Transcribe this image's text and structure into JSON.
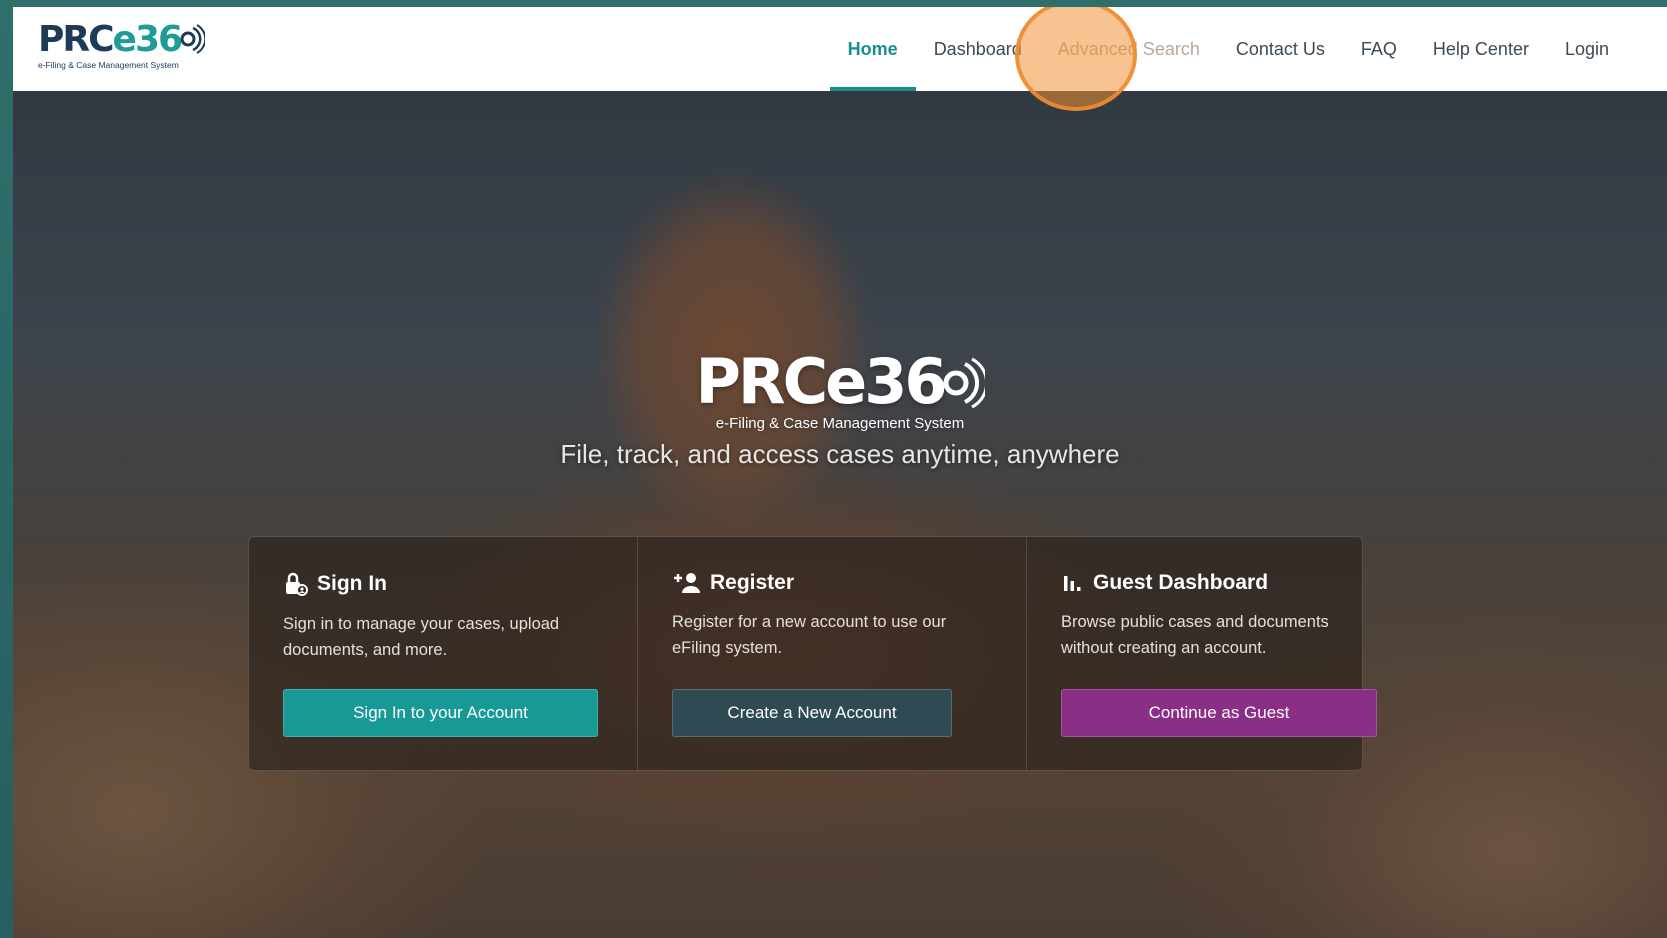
{
  "logo": {
    "prefix": "PRC",
    "accent": "e36",
    "subtitle": "e-Filing & Case Management System"
  },
  "nav": {
    "items": [
      {
        "label": "Home",
        "active": true
      },
      {
        "label": "Dashboard"
      },
      {
        "label": "Advanced Search"
      },
      {
        "label": "Contact Us"
      },
      {
        "label": "FAQ"
      },
      {
        "label": "Help Center"
      },
      {
        "label": "Login"
      }
    ]
  },
  "hero": {
    "logo_prefix": "PRC",
    "logo_accent": "e36",
    "logo_subtitle": "e-Filing & Case Management System",
    "tagline": "File, track, and access cases anytime, anywhere"
  },
  "cards": [
    {
      "title": "Sign In",
      "icon": "lock-user-icon",
      "description": "Sign in to manage your cases, upload documents, and more.",
      "button": "Sign In to your Account"
    },
    {
      "title": "Register",
      "icon": "user-plus-icon",
      "description": "Register for a new account to use our eFiling system.",
      "button": "Create a New Account"
    },
    {
      "title": "Guest Dashboard",
      "icon": "bar-chart-icon",
      "description": "Browse public cases and documents without creating an account.",
      "button": "Continue as Guest"
    }
  ],
  "colors": {
    "brand_teal": "#168f8d",
    "brand_navy": "#1d3b57",
    "guest_purple": "#8a2e86",
    "register_slate": "#2f4a52"
  }
}
